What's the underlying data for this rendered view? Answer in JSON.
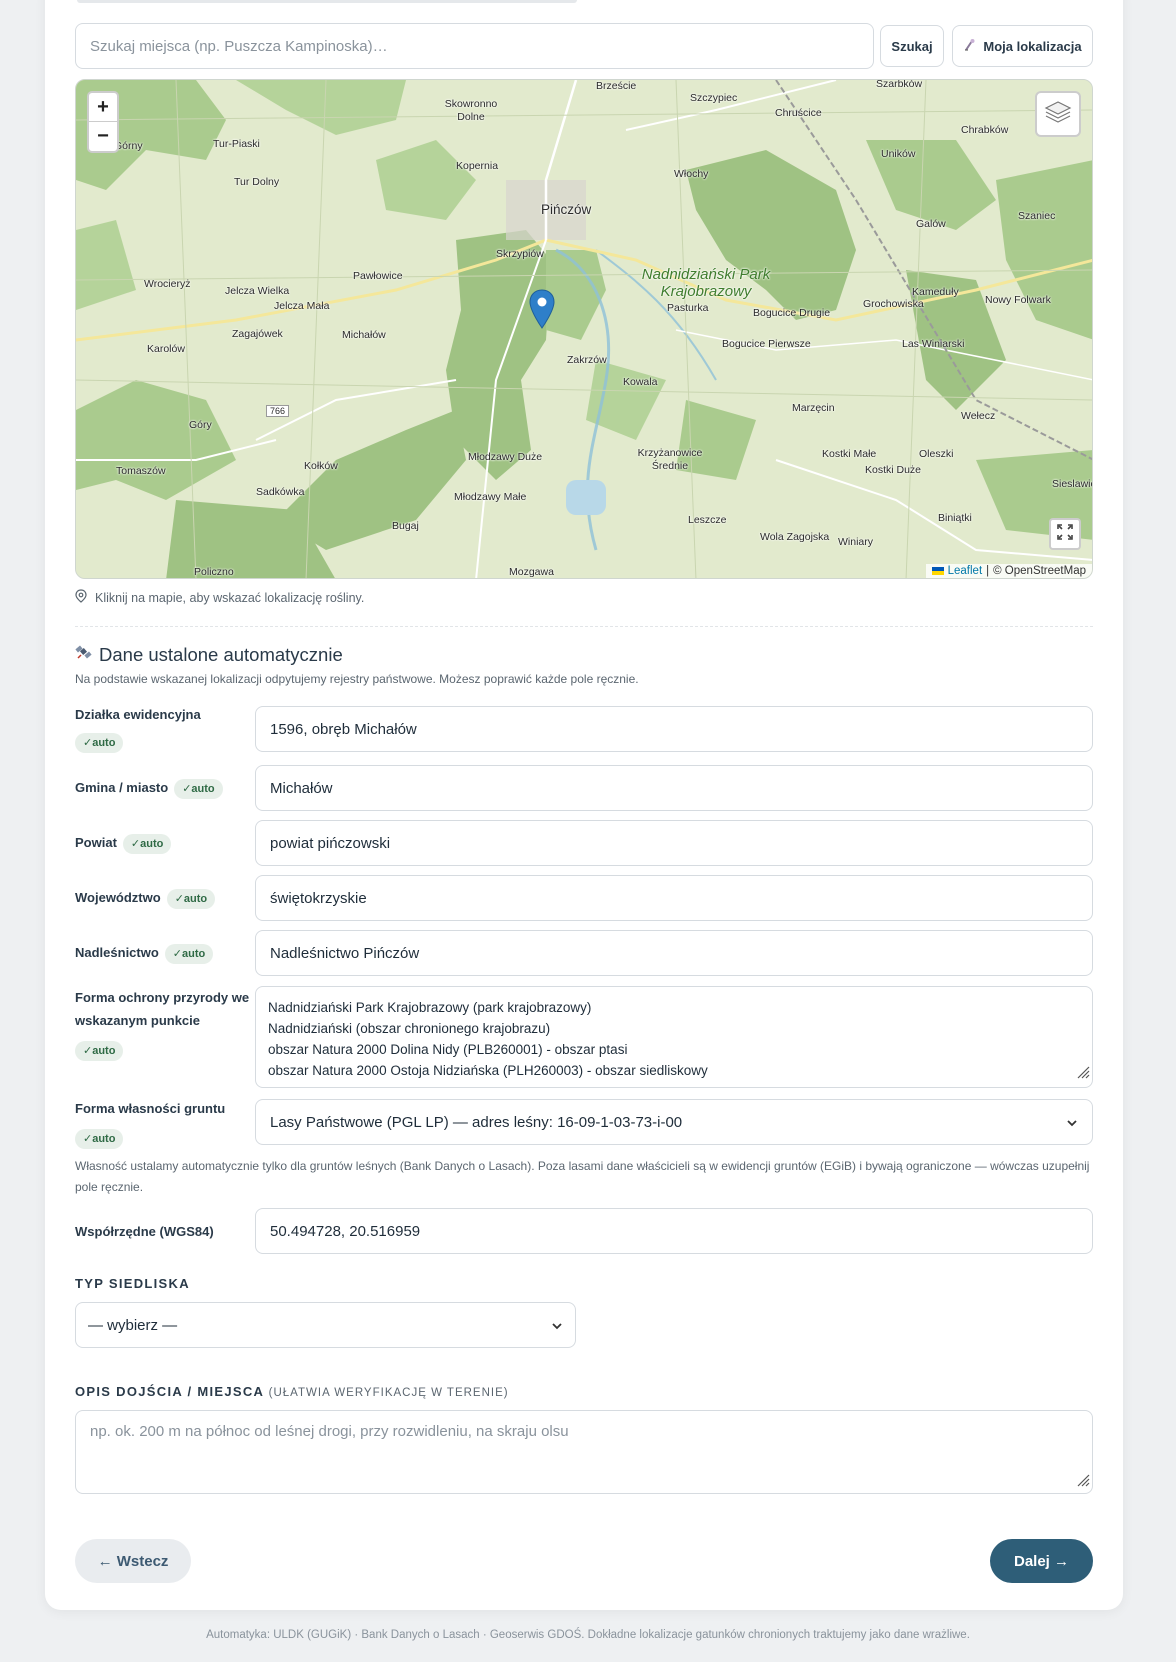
{
  "search": {
    "placeholder": "Szukaj miejsca (np. Puszcza Kampinoska)…",
    "search_button": "Szukaj",
    "location_button": "Moja lokalizacja"
  },
  "map": {
    "zoom_in": "+",
    "zoom_out": "−",
    "attribution_leaflet": "Leaflet",
    "attribution_sep": "|",
    "attribution_osm": "© OpenStreetMap",
    "labels": {
      "brzescie": "Brzeście",
      "szarbkow": "Szarbków",
      "skowronno": "Skowronno Dolne",
      "szczypiec": "Szczypiec",
      "chruscice": "Chruścice",
      "chrabkow": "Chrabków",
      "gorny": "Górny",
      "turpiaski": "Tur-Piaski",
      "kopernia": "Kopernia",
      "wlochy": "Włochy",
      "unikow": "Uników",
      "turdolny": "Tur Dolny",
      "pinczow": "Pińczów",
      "szaniec": "Szaniec",
      "galow": "Galów",
      "skrzypiow": "Skrzypiów",
      "pawlowice": "Pawłowice",
      "park": "Nadnidziański Park Krajobrazowy",
      "wrocieryz": "Wrocieryż",
      "jelczawielka": "Jelcza Wielka",
      "jelczamala": "Jelcza Mała",
      "kameduly": "Kameduły",
      "nowyfolwark": "Nowy Folwark",
      "pasturka": "Pasturka",
      "bogucicedrugie": "Bogucice Drugie",
      "grochowiska": "Grochowiska",
      "zagajowek": "Zagajówek",
      "michalow": "Michałów",
      "karolow": "Karolów",
      "zakrzow": "Zakrzów",
      "bogucicepierwsze": "Bogucice Pierwsze",
      "laswiniarski": "Las Winiarski",
      "kowala": "Kowala",
      "marzecin": "Marzęcin",
      "welecz": "Wełecz",
      "road766": "766",
      "gory": "Góry",
      "mlodzawyduze": "Młodzawy Duże",
      "krzyzanowice": "Krzyżanowice Średnie",
      "kostkimale": "Kostki Małe",
      "oleszki": "Oleszki",
      "tomaszow": "Tomaszów",
      "kolkow": "Kołków",
      "kostkiduze": "Kostki Duże",
      "sieslawice": "Sieslawic",
      "sadkowka": "Sadkówka",
      "mlodzawymale": "Młodzawy Małe",
      "bugaj": "Bugaj",
      "leszcze": "Leszcze",
      "biniatki": "Biniątki",
      "wolazagojska": "Wola Zagojska",
      "winiary": "Winiary",
      "policzno": "Policzno",
      "mozgawa": "Mozgawa"
    }
  },
  "hint": "Kliknij na mapie, aby wskazać lokalizację rośliny.",
  "auto_section": {
    "title": "Dane ustalone automatycznie",
    "subtitle": "Na podstawie wskazanej lokalizacji odpytujemy rejestry państwowe. Możesz poprawić każde pole ręcznie.",
    "badge": "✓auto",
    "fields": {
      "dzialka": {
        "label": "Działka ewidencyjna",
        "value": "1596, obręb Michałów"
      },
      "gmina": {
        "label": "Gmina / miasto",
        "value": "Michałów"
      },
      "powiat": {
        "label": "Powiat",
        "value": "powiat pińczowski"
      },
      "wojewodztwo": {
        "label": "Województwo",
        "value": "świętokrzyskie"
      },
      "nadlesnictwo": {
        "label": "Nadleśnictwo",
        "value": "Nadleśnictwo Pińczów"
      },
      "forma_ochrony": {
        "label": "Forma ochrony przyrody we wskazanym punkcie",
        "lines": [
          "Nadnidziański Park Krajobrazowy (park krajobrazowy)",
          "Nadnidziański (obszar chronionego krajobrazu)",
          "obszar Natura 2000 Dolina Nidy (PLB260001) - obszar ptasi",
          "obszar Natura 2000 Ostoja Nidziańska (PLH260003) - obszar siedliskowy"
        ]
      },
      "wlasnosc": {
        "label": "Forma własności gruntu",
        "value": "Lasy Państwowe (PGL LP) — adres leśny: 16-09-1-03-73-i-00"
      },
      "wspolrzedne": {
        "label": "Współrzędne (WGS84)",
        "value": "50.494728, 20.516959"
      }
    },
    "ownership_note": "Własność ustalamy automatycznie tylko dla gruntów leśnych (Bank Danych o Lasach). Poza lasami dane właścicieli są w ewidencji gruntów (EGiB) i bywają ograniczone — wówczas uzupełnij pole ręcznie."
  },
  "habitat": {
    "label": "TYP SIEDLISKA",
    "selected": "— wybierz —"
  },
  "description": {
    "label": "OPIS DOJŚCIA / MIEJSCA",
    "label_note": "(UŁATWIA WERYFIKACJĘ W TERENIE)",
    "placeholder": "np. ok. 200 m na północ od leśnej drogi, przy rozwidleniu, na skraju olsu"
  },
  "nav": {
    "back": "← Wstecz",
    "next": "Dalej →"
  },
  "footer": "Automatyka: ULDK (GUGiK) · Bank Danych o Lasach · Geoserwis GDOŚ. Dokładne lokalizacje gatunków chronionych traktujemy jako dane wrażliwe.",
  "colors": {
    "primary": "#2e5e78",
    "badge_bg": "#e7efe9",
    "badge_text": "#2f6a45",
    "forest": "#aacb8e",
    "marker": "#2e7fc9"
  }
}
